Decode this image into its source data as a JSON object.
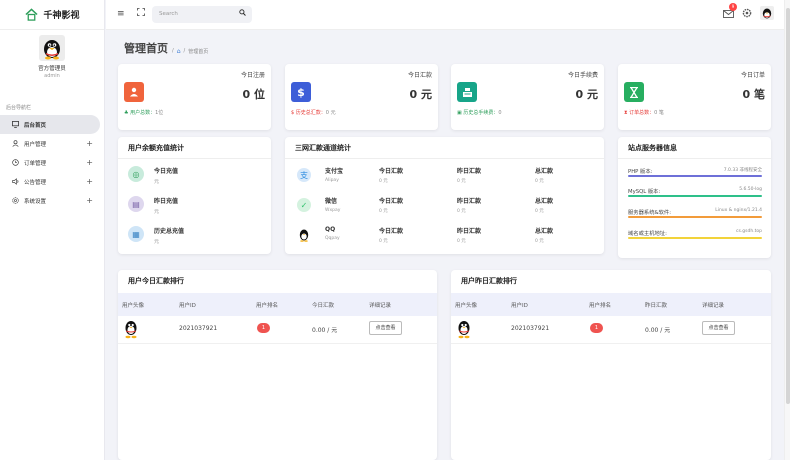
{
  "brand": {
    "name": "千神影视"
  },
  "profile": {
    "name": "官方管理员",
    "role": "admin"
  },
  "nav": {
    "title": "后台导航栏",
    "items": [
      {
        "label": "后台首页",
        "icon": "monitor-icon",
        "active": true,
        "expandable": false
      },
      {
        "label": "用户管理",
        "icon": "user-icon",
        "active": false,
        "expandable": true
      },
      {
        "label": "订单管理",
        "icon": "clock-icon",
        "active": false,
        "expandable": true
      },
      {
        "label": "公告管理",
        "icon": "speaker-icon",
        "active": false,
        "expandable": true
      },
      {
        "label": "系统设置",
        "icon": "gear-icon",
        "active": false,
        "expandable": true
      }
    ],
    "plus": "+"
  },
  "topbar": {
    "search_placeholder": "Search",
    "notify_count": "9"
  },
  "page": {
    "title": "管理首页",
    "breadcrumb_sep": "/",
    "breadcrumb": "管理首页"
  },
  "stats": [
    {
      "label": "今日注册",
      "value": "0 位",
      "icon": "person-icon",
      "color": "#f0643c",
      "foot_label": "用户总数：",
      "foot_value": "1位",
      "foot_color": "#2e9e5b"
    },
    {
      "label": "今日汇款",
      "value": "0 元",
      "icon": "dollar-icon",
      "color": "#3d5ed8",
      "foot_label": "历史总汇款：",
      "foot_value": "0 元",
      "foot_color": "#e53935"
    },
    {
      "label": "今日手续费",
      "value": "0 元",
      "icon": "cash-register-icon",
      "color": "#17a589",
      "foot_label": "历史总手续费：",
      "foot_value": "0",
      "foot_color": "#2e9e5b"
    },
    {
      "label": "今日订单",
      "value": "0 笔",
      "icon": "hourglass-icon",
      "color": "#27ae60",
      "foot_label": "订单总数：",
      "foot_value": "0 笔",
      "foot_color": "#e53935"
    }
  ],
  "recharge": {
    "title": "用户余额充值统计",
    "items": [
      {
        "label": "今日充值",
        "value": "元",
        "icon": "recharge-icon",
        "color": "#c8ebdc",
        "fg": "#2e9e5b"
      },
      {
        "label": "昨日充值",
        "value": "元",
        "icon": "calendar-icon",
        "color": "#ded7ee",
        "fg": "#7a63a8"
      },
      {
        "label": "历史总充值",
        "value": "元",
        "icon": "history-icon",
        "color": "#cfe5f7",
        "fg": "#3b84c4"
      }
    ]
  },
  "channels": {
    "title": "三网汇款通道统计",
    "col_today": "今日汇款",
    "col_yesterday": "昨日汇款",
    "col_total": "总汇款",
    "unit": "0 元",
    "rows": [
      {
        "name": "支付宝",
        "code": "Alipay",
        "icon": "alipay-icon",
        "color": "#2f8de0"
      },
      {
        "name": "微信",
        "code": "Wxpay",
        "icon": "wechat-icon",
        "color": "#2ec06b"
      },
      {
        "name": "QQ",
        "code": "Qqpay",
        "icon": "qq-penguin-icon",
        "color": "#222222"
      }
    ]
  },
  "siteinfo": {
    "title": "站点服务器信息",
    "rows": [
      {
        "key": "PHP 版本:",
        "value": "7.0.33 非线程安全",
        "color": "#6e70d8"
      },
      {
        "key": "MySQL 版本:",
        "value": "5.6.50-log",
        "color": "#2ec08a"
      },
      {
        "key": "服务器系统&软件:",
        "value": "Linux & nginx/1.21.4",
        "color": "#f29b3a"
      },
      {
        "key": "域名或主机地址:",
        "value": "cs.gsdh.top",
        "color": "#f2d33a"
      }
    ]
  },
  "rank_today": {
    "title": "用户今日汇款排行",
    "headers": [
      "用户头像",
      "用户ID",
      "用户排名",
      "今日汇款",
      "详细记录"
    ],
    "rows": [
      {
        "id": "2021037921",
        "rank": "1",
        "amount": "0.00 / 元",
        "action": "点击查看"
      }
    ]
  },
  "rank_yesterday": {
    "title": "用户昨日汇款排行",
    "headers": [
      "用户头像",
      "用户ID",
      "用户排名",
      "昨日汇款",
      "详细记录"
    ],
    "rows": [
      {
        "id": "2021037921",
        "rank": "1",
        "amount": "0.00 / 元",
        "action": "点击查看"
      }
    ]
  }
}
